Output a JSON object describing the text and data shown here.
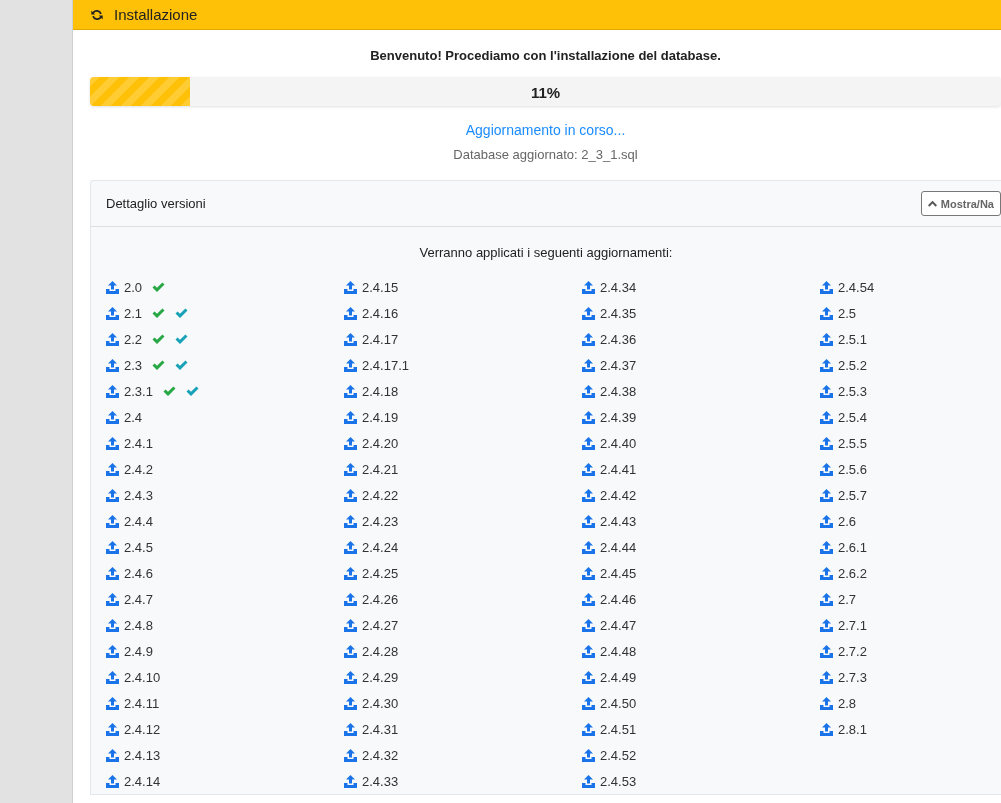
{
  "header": {
    "title": "Installazione"
  },
  "welcome": "Benvenuto! Procediamo con l'installazione del database.",
  "progress": {
    "level": 0.11,
    "reading": "11%"
  },
  "status": "Aggiornamento in corso...",
  "last_update": "Database aggiornato: 2_3_1.sql",
  "details": {
    "title": "Dettaglio versioni",
    "toggle_button": "Mostra/Na",
    "intro": "Verranno applicati i seguenti aggiornamenti:",
    "versions": [
      {
        "version": "2.0",
        "applied": true,
        "confirmed": false
      },
      {
        "version": "2.1",
        "applied": true,
        "confirmed": true
      },
      {
        "version": "2.2",
        "applied": true,
        "confirmed": true
      },
      {
        "version": "2.3",
        "applied": true,
        "confirmed": true
      },
      {
        "version": "2.3.1",
        "applied": true,
        "confirmed": true
      },
      {
        "version": "2.4",
        "applied": false,
        "confirmed": false
      },
      {
        "version": "2.4.1",
        "applied": false,
        "confirmed": false
      },
      {
        "version": "2.4.2",
        "applied": false,
        "confirmed": false
      },
      {
        "version": "2.4.3",
        "applied": false,
        "confirmed": false
      },
      {
        "version": "2.4.4",
        "applied": false,
        "confirmed": false
      },
      {
        "version": "2.4.5",
        "applied": false,
        "confirmed": false
      },
      {
        "version": "2.4.6",
        "applied": false,
        "confirmed": false
      },
      {
        "version": "2.4.7",
        "applied": false,
        "confirmed": false
      },
      {
        "version": "2.4.8",
        "applied": false,
        "confirmed": false
      },
      {
        "version": "2.4.9",
        "applied": false,
        "confirmed": false
      },
      {
        "version": "2.4.10",
        "applied": false,
        "confirmed": false
      },
      {
        "version": "2.4.11",
        "applied": false,
        "confirmed": false
      },
      {
        "version": "2.4.12",
        "applied": false,
        "confirmed": false
      },
      {
        "version": "2.4.13",
        "applied": false,
        "confirmed": false
      },
      {
        "version": "2.4.14",
        "applied": false,
        "confirmed": false
      },
      {
        "version": "2.4.15",
        "applied": false,
        "confirmed": false
      },
      {
        "version": "2.4.16",
        "applied": false,
        "confirmed": false
      },
      {
        "version": "2.4.17",
        "applied": false,
        "confirmed": false
      },
      {
        "version": "2.4.17.1",
        "applied": false,
        "confirmed": false
      },
      {
        "version": "2.4.18",
        "applied": false,
        "confirmed": false
      },
      {
        "version": "2.4.19",
        "applied": false,
        "confirmed": false
      },
      {
        "version": "2.4.20",
        "applied": false,
        "confirmed": false
      },
      {
        "version": "2.4.21",
        "applied": false,
        "confirmed": false
      },
      {
        "version": "2.4.22",
        "applied": false,
        "confirmed": false
      },
      {
        "version": "2.4.23",
        "applied": false,
        "confirmed": false
      },
      {
        "version": "2.4.24",
        "applied": false,
        "confirmed": false
      },
      {
        "version": "2.4.25",
        "applied": false,
        "confirmed": false
      },
      {
        "version": "2.4.26",
        "applied": false,
        "confirmed": false
      },
      {
        "version": "2.4.27",
        "applied": false,
        "confirmed": false
      },
      {
        "version": "2.4.28",
        "applied": false,
        "confirmed": false
      },
      {
        "version": "2.4.29",
        "applied": false,
        "confirmed": false
      },
      {
        "version": "2.4.30",
        "applied": false,
        "confirmed": false
      },
      {
        "version": "2.4.31",
        "applied": false,
        "confirmed": false
      },
      {
        "version": "2.4.32",
        "applied": false,
        "confirmed": false
      },
      {
        "version": "2.4.33",
        "applied": false,
        "confirmed": false
      },
      {
        "version": "2.4.34",
        "applied": false,
        "confirmed": false
      },
      {
        "version": "2.4.35",
        "applied": false,
        "confirmed": false
      },
      {
        "version": "2.4.36",
        "applied": false,
        "confirmed": false
      },
      {
        "version": "2.4.37",
        "applied": false,
        "confirmed": false
      },
      {
        "version": "2.4.38",
        "applied": false,
        "confirmed": false
      },
      {
        "version": "2.4.39",
        "applied": false,
        "confirmed": false
      },
      {
        "version": "2.4.40",
        "applied": false,
        "confirmed": false
      },
      {
        "version": "2.4.41",
        "applied": false,
        "confirmed": false
      },
      {
        "version": "2.4.42",
        "applied": false,
        "confirmed": false
      },
      {
        "version": "2.4.43",
        "applied": false,
        "confirmed": false
      },
      {
        "version": "2.4.44",
        "applied": false,
        "confirmed": false
      },
      {
        "version": "2.4.45",
        "applied": false,
        "confirmed": false
      },
      {
        "version": "2.4.46",
        "applied": false,
        "confirmed": false
      },
      {
        "version": "2.4.47",
        "applied": false,
        "confirmed": false
      },
      {
        "version": "2.4.48",
        "applied": false,
        "confirmed": false
      },
      {
        "version": "2.4.49",
        "applied": false,
        "confirmed": false
      },
      {
        "version": "2.4.50",
        "applied": false,
        "confirmed": false
      },
      {
        "version": "2.4.51",
        "applied": false,
        "confirmed": false
      },
      {
        "version": "2.4.52",
        "applied": false,
        "confirmed": false
      },
      {
        "version": "2.4.53",
        "applied": false,
        "confirmed": false
      },
      {
        "version": "2.4.54",
        "applied": false,
        "confirmed": false
      },
      {
        "version": "2.5",
        "applied": false,
        "confirmed": false
      },
      {
        "version": "2.5.1",
        "applied": false,
        "confirmed": false
      },
      {
        "version": "2.5.2",
        "applied": false,
        "confirmed": false
      },
      {
        "version": "2.5.3",
        "applied": false,
        "confirmed": false
      },
      {
        "version": "2.5.4",
        "applied": false,
        "confirmed": false
      },
      {
        "version": "2.5.5",
        "applied": false,
        "confirmed": false
      },
      {
        "version": "2.5.6",
        "applied": false,
        "confirmed": false
      },
      {
        "version": "2.5.7",
        "applied": false,
        "confirmed": false
      },
      {
        "version": "2.6",
        "applied": false,
        "confirmed": false
      },
      {
        "version": "2.6.1",
        "applied": false,
        "confirmed": false
      },
      {
        "version": "2.6.2",
        "applied": false,
        "confirmed": false
      },
      {
        "version": "2.7",
        "applied": false,
        "confirmed": false
      },
      {
        "version": "2.7.1",
        "applied": false,
        "confirmed": false
      },
      {
        "version": "2.7.2",
        "applied": false,
        "confirmed": false
      },
      {
        "version": "2.7.3",
        "applied": false,
        "confirmed": false
      },
      {
        "version": "2.8",
        "applied": false,
        "confirmed": false
      },
      {
        "version": "2.8.1",
        "applied": false,
        "confirmed": false
      }
    ]
  }
}
